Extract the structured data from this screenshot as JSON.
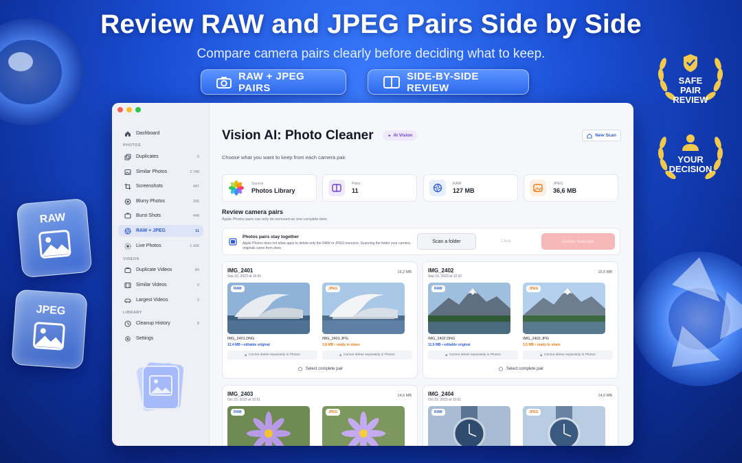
{
  "hero": {
    "title": "Review RAW and JPEG Pairs Side by Side",
    "subtitle": "Compare camera pairs clearly before deciding what to keep.",
    "pill_left": "RAW + JPEG PAIRS",
    "pill_right": "SIDE-BY-SIDE REVIEW"
  },
  "decor": {
    "tile_raw": "RAW",
    "tile_jpeg": "JPEG",
    "badge_top": [
      "SAFE",
      "PAIR",
      "REVIEW"
    ],
    "badge_bottom": [
      "YOUR",
      "DECISION"
    ],
    "badge_color": "#f2c94c"
  },
  "sidebar": {
    "dashboard": "Dashboard",
    "section_photos": "PHOTOS",
    "section_videos": "VIDEOS",
    "section_library": "LIBRARY",
    "items": [
      {
        "label": "Duplicates",
        "count": "0"
      },
      {
        "label": "Similar Photos",
        "count": "2.748"
      },
      {
        "label": "Screenshots",
        "count": "447"
      },
      {
        "label": "Blurry Photos",
        "count": "206"
      },
      {
        "label": "Burst Shots",
        "count": "448"
      },
      {
        "label": "RAW + JPEG",
        "count": "11"
      },
      {
        "label": "Live Photos",
        "count": "1.436"
      },
      {
        "label": "Duplicate Videos",
        "count": "84"
      },
      {
        "label": "Similar Videos",
        "count": "0"
      },
      {
        "label": "Largest Videos",
        "count": "2"
      },
      {
        "label": "Cleanup History",
        "count": "8"
      },
      {
        "label": "Settings",
        "count": ""
      }
    ]
  },
  "main": {
    "title": "Vision AI: Photo Cleaner",
    "ai_badge": "AI Vision",
    "new_scan": "New Scan",
    "subtitle": "Choose what you want to keep from each camera pair.",
    "stats": [
      {
        "label": "Source",
        "value": "Photos Library"
      },
      {
        "label": "Pairs",
        "value": "11"
      },
      {
        "label": "RAW",
        "value": "127 MB"
      },
      {
        "label": "JPEG",
        "value": "36,6 MB"
      }
    ],
    "section_title": "Review camera pairs",
    "section_sub": "Apple Photos pairs can only be removed as one complete item.",
    "notice_title": "Photos pairs stay together",
    "notice_desc": "Apple Photos does not allow apps to delete only the RAW or JPEG resource. Scanning the folder your camera originals came from does.",
    "scan_folder": "Scan a folder",
    "clear": "Clear",
    "delete_selected": "Delete Selected",
    "raw_tag": "RAW",
    "jpeg_tag": "JPEG",
    "lock_text": "Cannot delete separately in Photos",
    "select_pair": "Select complete pair",
    "accent_blue": "#2b5bd8",
    "accent_orange": "#f07b14",
    "pairs": [
      {
        "name": "IMG_2401",
        "date": "Sep 16, 2023 at 16:41",
        "size": "16,2 MB",
        "raw_file": "IMG_2401.DNG",
        "raw_meta": "12,4 MB • editable original",
        "jpg_file": "IMG_2401.JPG",
        "jpg_meta": "3,8 MB • ready to share"
      },
      {
        "name": "IMG_2402",
        "date": "Sep 16, 2023 at 12:32",
        "size": "15,5 MB",
        "raw_file": "IMG_2402.DNG",
        "raw_meta": "11,9 MB • editable original",
        "jpg_file": "IMG_2402.JPG",
        "jpg_meta": "3,5 MB • ready to share"
      },
      {
        "name": "IMG_2403",
        "date": "Oct 23, 2023 at 10:51",
        "size": "14,6 MB"
      },
      {
        "name": "IMG_2404",
        "date": "Oct 23, 2023 at 10:51",
        "size": "14,6 MB"
      }
    ]
  }
}
